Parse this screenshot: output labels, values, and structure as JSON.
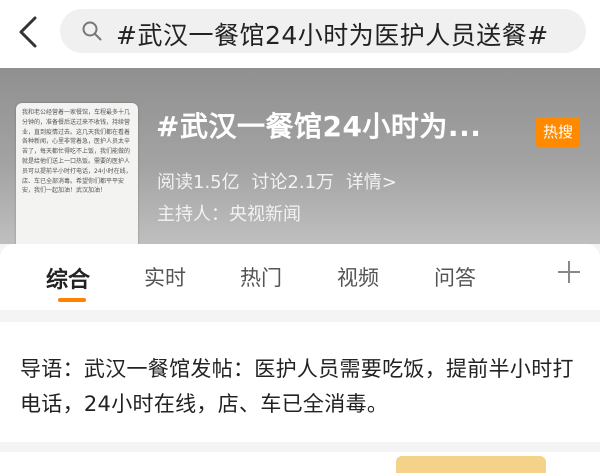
{
  "search": {
    "query": "#武汉一餐馆24小时为医护人员送餐#"
  },
  "topic": {
    "title": "#武汉一餐馆24小时为...",
    "badge": "热搜",
    "reads": "阅读1.5亿",
    "discussions": "讨论2.1万",
    "details_link": "详情>",
    "host": "主持人：央视新闻",
    "thumbnail_text": "我和老公经营着一家餐馆，车程最多十几分钟的，准备餐后送过来不收钱，持续营业，直到疫情过去。这几天我们都在看着各种新闻，心里非常着急，医护人员太辛苦了，每天都忙得吃不上饭，我们能做的就是给他们送上一口热饭。需要的医护人员可以提前半小时打电话，24小时在线，店、车已全部消毒。希望你们都平平安安，我们一起加油！武汉加油！"
  },
  "tabs": {
    "items": [
      "综合",
      "实时",
      "热门",
      "视频",
      "问答"
    ],
    "active_color": "#ff8200"
  },
  "guide": {
    "text": "导语：武汉一餐馆发帖：医护人员需要吃饭，提前半小时打电话，24小时在线，店、车已全消毒。"
  },
  "colors": {
    "badge": "#ff8a00",
    "accent": "#ff8200"
  }
}
